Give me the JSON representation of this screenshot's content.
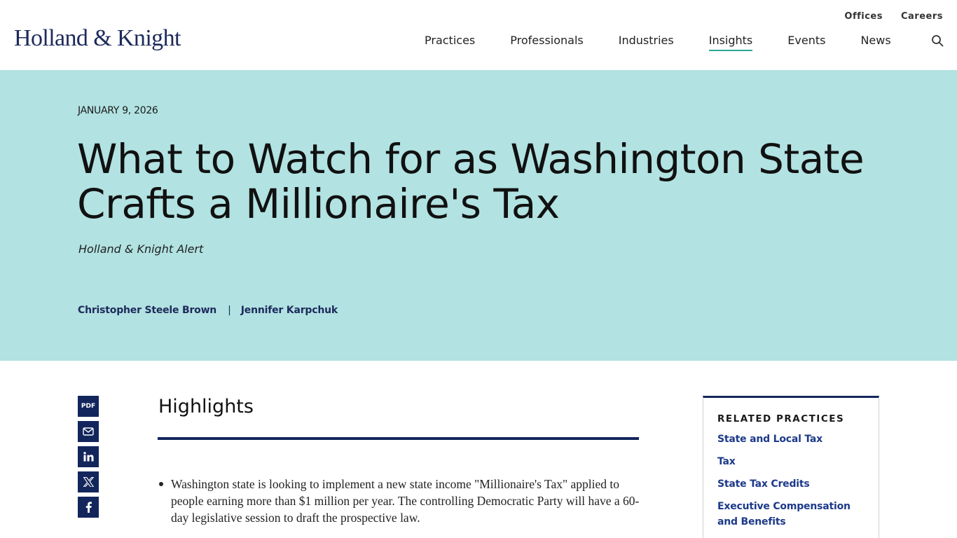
{
  "header": {
    "logo": "Holland & Knight",
    "utility_nav": [
      "Offices",
      "Careers"
    ],
    "main_nav": [
      {
        "label": "Practices",
        "active": false
      },
      {
        "label": "Professionals",
        "active": false
      },
      {
        "label": "Industries",
        "active": false
      },
      {
        "label": "Insights",
        "active": true
      },
      {
        "label": "Events",
        "active": false
      },
      {
        "label": "News",
        "active": false
      }
    ],
    "search_icon": "search-icon"
  },
  "article": {
    "date": "JANUARY 9, 2026",
    "title": "What to Watch for as Washington State Crafts a Millionaire's Tax",
    "type": "Holland & Knight Alert",
    "authors": [
      "Christopher Steele Brown",
      "Jennifer Karpchuk"
    ],
    "author_separator": "|"
  },
  "share": {
    "pdf_label": "PDF",
    "icons": [
      "email-icon",
      "linkedin-icon",
      "x-icon",
      "facebook-icon"
    ]
  },
  "highlights": {
    "heading": "Highlights",
    "items": [
      "Washington state is looking to implement a new state income \"Millionaire's Tax\" applied to people earning more than $1 million per year. The controlling Democratic Party will have a 60-day legislative session to draft the prospective law."
    ]
  },
  "related_practices": {
    "heading": "RELATED PRACTICES",
    "items": [
      "State and Local Tax",
      "Tax",
      "State Tax Credits",
      "Executive Compensation and Benefits"
    ]
  },
  "colors": {
    "brand_navy": "#13265c",
    "hero_bg": "#b2e2e2",
    "nav_active_underline": "#2aa892",
    "link_blue": "#1d3a8a"
  }
}
